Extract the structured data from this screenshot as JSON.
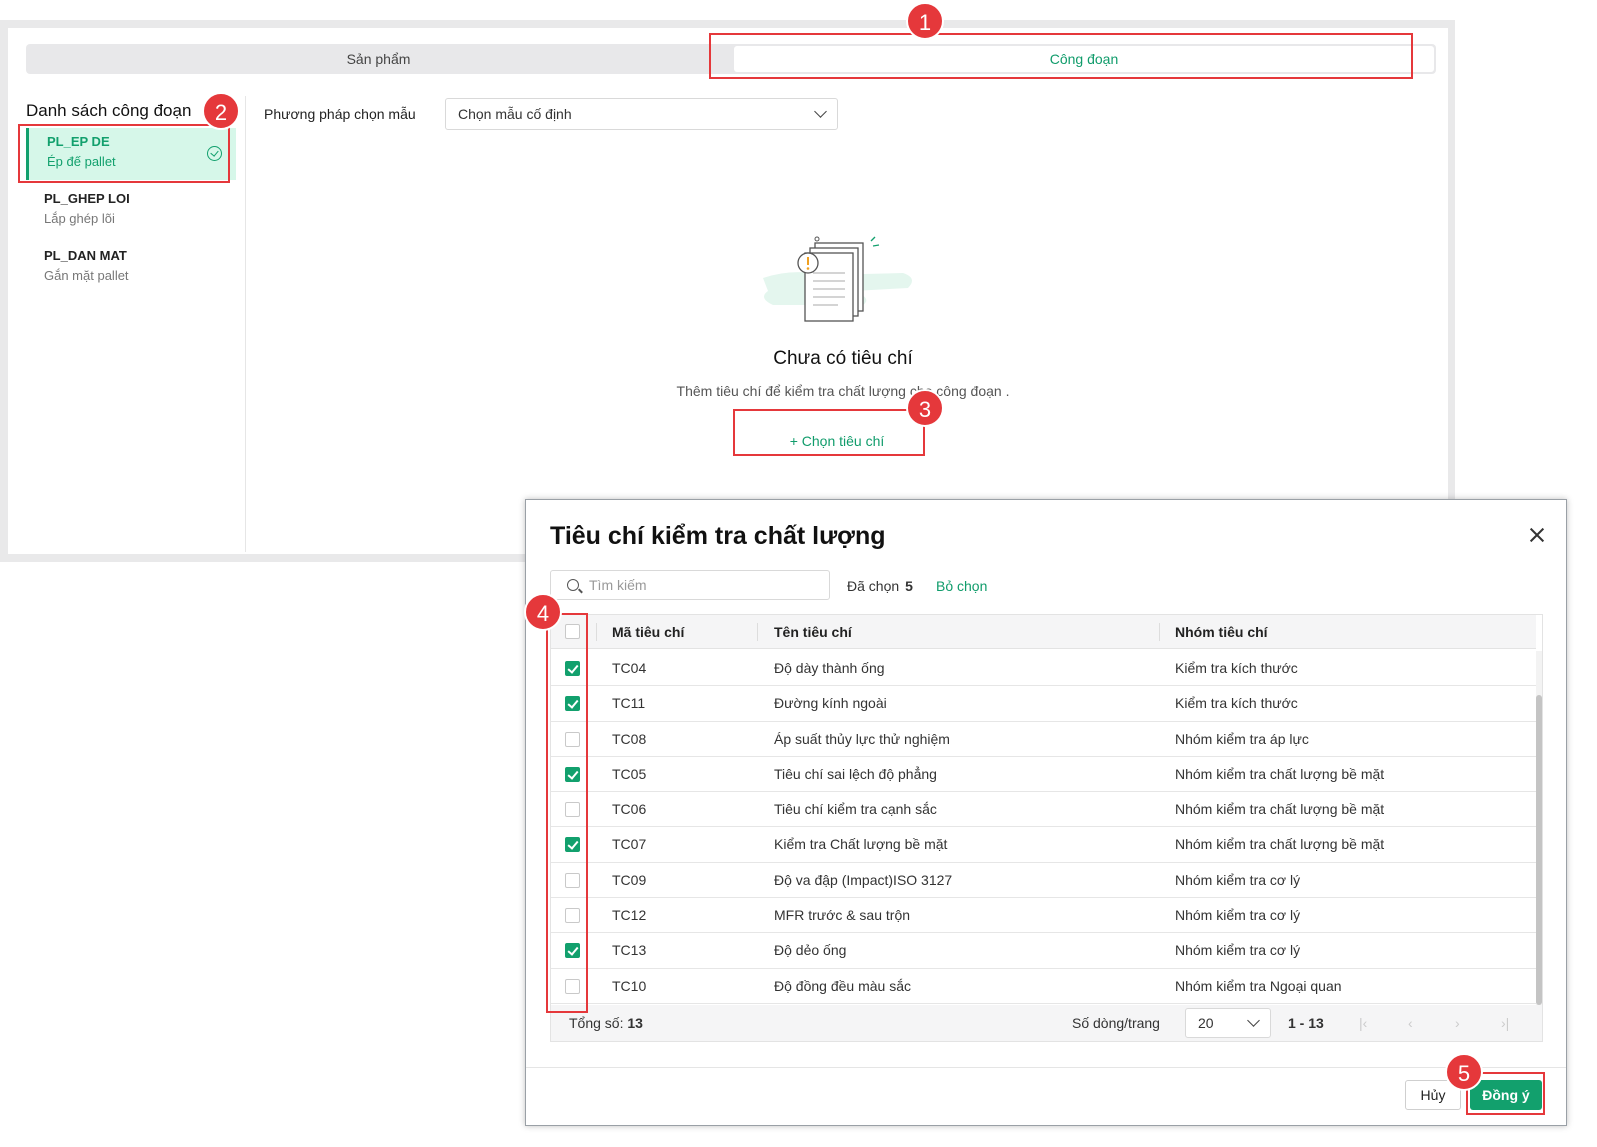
{
  "tabs": [
    {
      "label": "Sản phẩm"
    },
    {
      "label": "Công đoạn"
    }
  ],
  "sidebar": {
    "title": "Danh sách công đoạn",
    "items": [
      {
        "code": "PL_EP DE",
        "name": "Ép đế pallet"
      },
      {
        "code": "PL_GHEP LOI",
        "name": "Lắp ghép lõi"
      },
      {
        "code": "PL_DAN MAT",
        "name": "Gắn mặt pallet"
      }
    ]
  },
  "method": {
    "label": "Phương pháp chọn mẫu",
    "value": "Chọn mẫu cố định"
  },
  "empty": {
    "title": "Chưa có tiêu chí",
    "description": "Thêm tiêu chí để kiểm tra chất lượng cho công đoạn .",
    "button": "Chọn tiêu chí"
  },
  "callouts": [
    "1",
    "2",
    "3",
    "4",
    "5"
  ],
  "modal": {
    "title": "Tiêu chí kiểm tra chất lượng",
    "search_placeholder": "Tìm kiếm",
    "selected_label": "Đã chọn",
    "selected_count": "5",
    "deselect": "Bỏ chọn",
    "columns": [
      "Mã tiêu chí",
      "Tên tiêu chí",
      "Nhóm tiêu chí"
    ],
    "rows": [
      {
        "checked": true,
        "code": "TC04",
        "name": "Độ dày thành ống",
        "group": "Kiểm tra kích thước"
      },
      {
        "checked": true,
        "code": "TC11",
        "name": "Đường kính ngoài",
        "group": "Kiểm tra kích thước"
      },
      {
        "checked": false,
        "code": "TC08",
        "name": "Áp suất thủy lực thử nghiệm",
        "group": "Nhóm kiểm tra áp lực"
      },
      {
        "checked": true,
        "code": "TC05",
        "name": "Tiêu chí sai lệch độ phẳng",
        "group": "Nhóm kiểm tra chất lượng bề mặt"
      },
      {
        "checked": false,
        "code": "TC06",
        "name": "Tiêu chí kiểm tra cạnh sắc",
        "group": "Nhóm kiểm tra chất lượng bề mặt"
      },
      {
        "checked": true,
        "code": "TC07",
        "name": "Kiểm tra Chất lượng bề mặt",
        "group": "Nhóm kiểm tra chất lượng bề mặt"
      },
      {
        "checked": false,
        "code": "TC09",
        "name": "Độ va đập (Impact)ISO 3127",
        "group": "Nhóm kiểm tra cơ lý"
      },
      {
        "checked": false,
        "code": "TC12",
        "name": "MFR trước & sau trộn",
        "group": "Nhóm kiểm tra cơ lý"
      },
      {
        "checked": true,
        "code": "TC13",
        "name": "Độ dẻo ống",
        "group": "Nhóm kiểm tra cơ lý"
      },
      {
        "checked": false,
        "code": "TC10",
        "name": "Độ đồng đều màu sắc",
        "group": "Nhóm kiểm tra Ngoại quan"
      }
    ],
    "footer": {
      "total_label": "Tổng số:",
      "total_value": "13",
      "rows_per_page_label": "Số dòng/trang",
      "page_size": "20",
      "range": "1 - 13"
    },
    "cancel": "Hủy",
    "ok": "Đồng ý"
  },
  "colors": {
    "accent": "#12a06d",
    "callout": "#e5383b"
  }
}
